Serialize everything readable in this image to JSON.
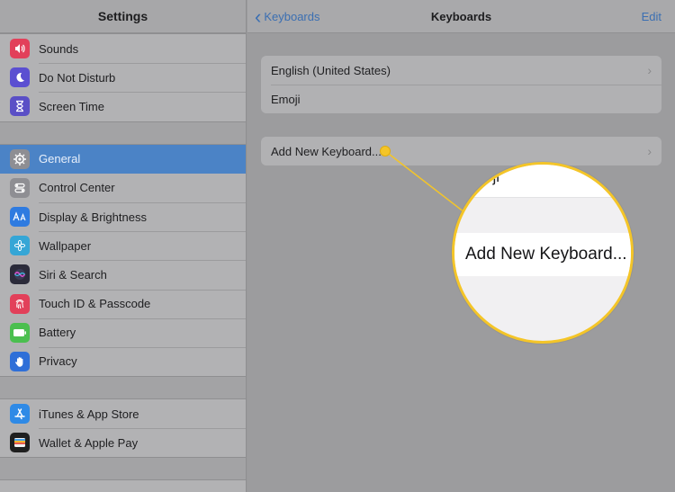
{
  "sidebar": {
    "title": "Settings",
    "group1": [
      {
        "label": "Sounds",
        "icon": "speaker-icon",
        "color": "#e2405a"
      },
      {
        "label": "Do Not Disturb",
        "icon": "moon-icon",
        "color": "#5b4fd1"
      },
      {
        "label": "Screen Time",
        "icon": "hourglass-icon",
        "color": "#5a4fc6"
      }
    ],
    "group2": [
      {
        "label": "General",
        "icon": "gear-icon",
        "color": "#8e8e93",
        "selected": true
      },
      {
        "label": "Control Center",
        "icon": "toggles-icon",
        "color": "#8e8e93"
      },
      {
        "label": "Display & Brightness",
        "icon": "text-size-icon",
        "color": "#2f7be0"
      },
      {
        "label": "Wallpaper",
        "icon": "flower-icon",
        "color": "#35a6d6"
      },
      {
        "label": "Siri & Search",
        "icon": "siri-icon",
        "color": "#2b2b3a"
      },
      {
        "label": "Touch ID & Passcode",
        "icon": "fingerprint-icon",
        "color": "#e2405a"
      },
      {
        "label": "Battery",
        "icon": "battery-icon",
        "color": "#4bbf4f"
      },
      {
        "label": "Privacy",
        "icon": "hand-icon",
        "color": "#2f6fd8"
      }
    ],
    "group3": [
      {
        "label": "iTunes & App Store",
        "icon": "app-store-icon",
        "color": "#2f8ae6"
      },
      {
        "label": "Wallet & Apple Pay",
        "icon": "wallet-icon",
        "color": "#1f1f1f"
      }
    ]
  },
  "detail": {
    "back_label": "Keyboards",
    "title": "Keyboards",
    "edit_label": "Edit",
    "keyboards": [
      {
        "label": "English (United States)",
        "chevron": true
      },
      {
        "label": "Emoji",
        "chevron": false
      }
    ],
    "add_keyboard_label": "Add New Keyboard..."
  },
  "magnifier": {
    "fragment_text": "oji",
    "zoomed_label": "Add New Keyboard..."
  },
  "colors": {
    "accent": "#3b6fb2",
    "selection": "#4b83c6",
    "callout": "#f4c528"
  }
}
